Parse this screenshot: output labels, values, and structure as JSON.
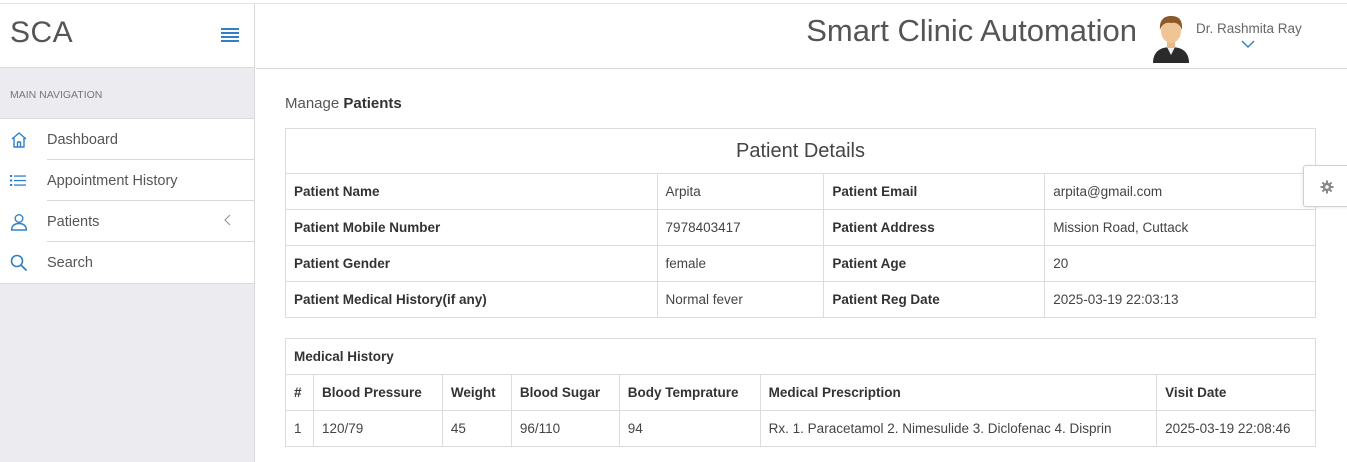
{
  "brand": {
    "short": "SCA",
    "app_title": "Smart Clinic Automation"
  },
  "user": {
    "name": "Dr. Rashmita Ray"
  },
  "sidebar": {
    "heading": "MAIN NAVIGATION",
    "items": [
      {
        "label": "Dashboard",
        "icon": "home-icon"
      },
      {
        "label": "Appointment History",
        "icon": "list-icon"
      },
      {
        "label": "Patients",
        "icon": "user-icon"
      },
      {
        "label": "Search",
        "icon": "search-icon"
      }
    ]
  },
  "breadcrumb": {
    "prefix": "Manage",
    "current": "Patients"
  },
  "patient_details": {
    "title": "Patient Details",
    "rows": [
      {
        "l1": "Patient Name",
        "v1": "Arpita",
        "l2": "Patient Email",
        "v2": "arpita@gmail.com"
      },
      {
        "l1": "Patient Mobile Number",
        "v1": "7978403417",
        "l2": "Patient Address",
        "v2": "Mission Road, Cuttack"
      },
      {
        "l1": "Patient Gender",
        "v1": "female",
        "l2": "Patient Age",
        "v2": "20"
      },
      {
        "l1": "Patient Medical History(if any)",
        "v1": "Normal fever",
        "l2": "Patient Reg Date",
        "v2": "2025-03-19 22:03:13"
      }
    ]
  },
  "medical_history": {
    "title": "Medical History",
    "columns": [
      "#",
      "Blood Pressure",
      "Weight",
      "Blood Sugar",
      "Body Temprature",
      "Medical Prescription",
      "Visit Date"
    ],
    "rows": [
      [
        "1",
        "120/79",
        "45",
        "96/110",
        "94",
        "Rx. 1. Paracetamol 2. Nimesulide 3. Diclofenac 4. Disprin",
        "2025-03-19 22:08:46"
      ]
    ]
  },
  "colors": {
    "accent": "#2f80c8",
    "sidebar_bg": "#ececf0",
    "border": "#dcdcdc"
  }
}
